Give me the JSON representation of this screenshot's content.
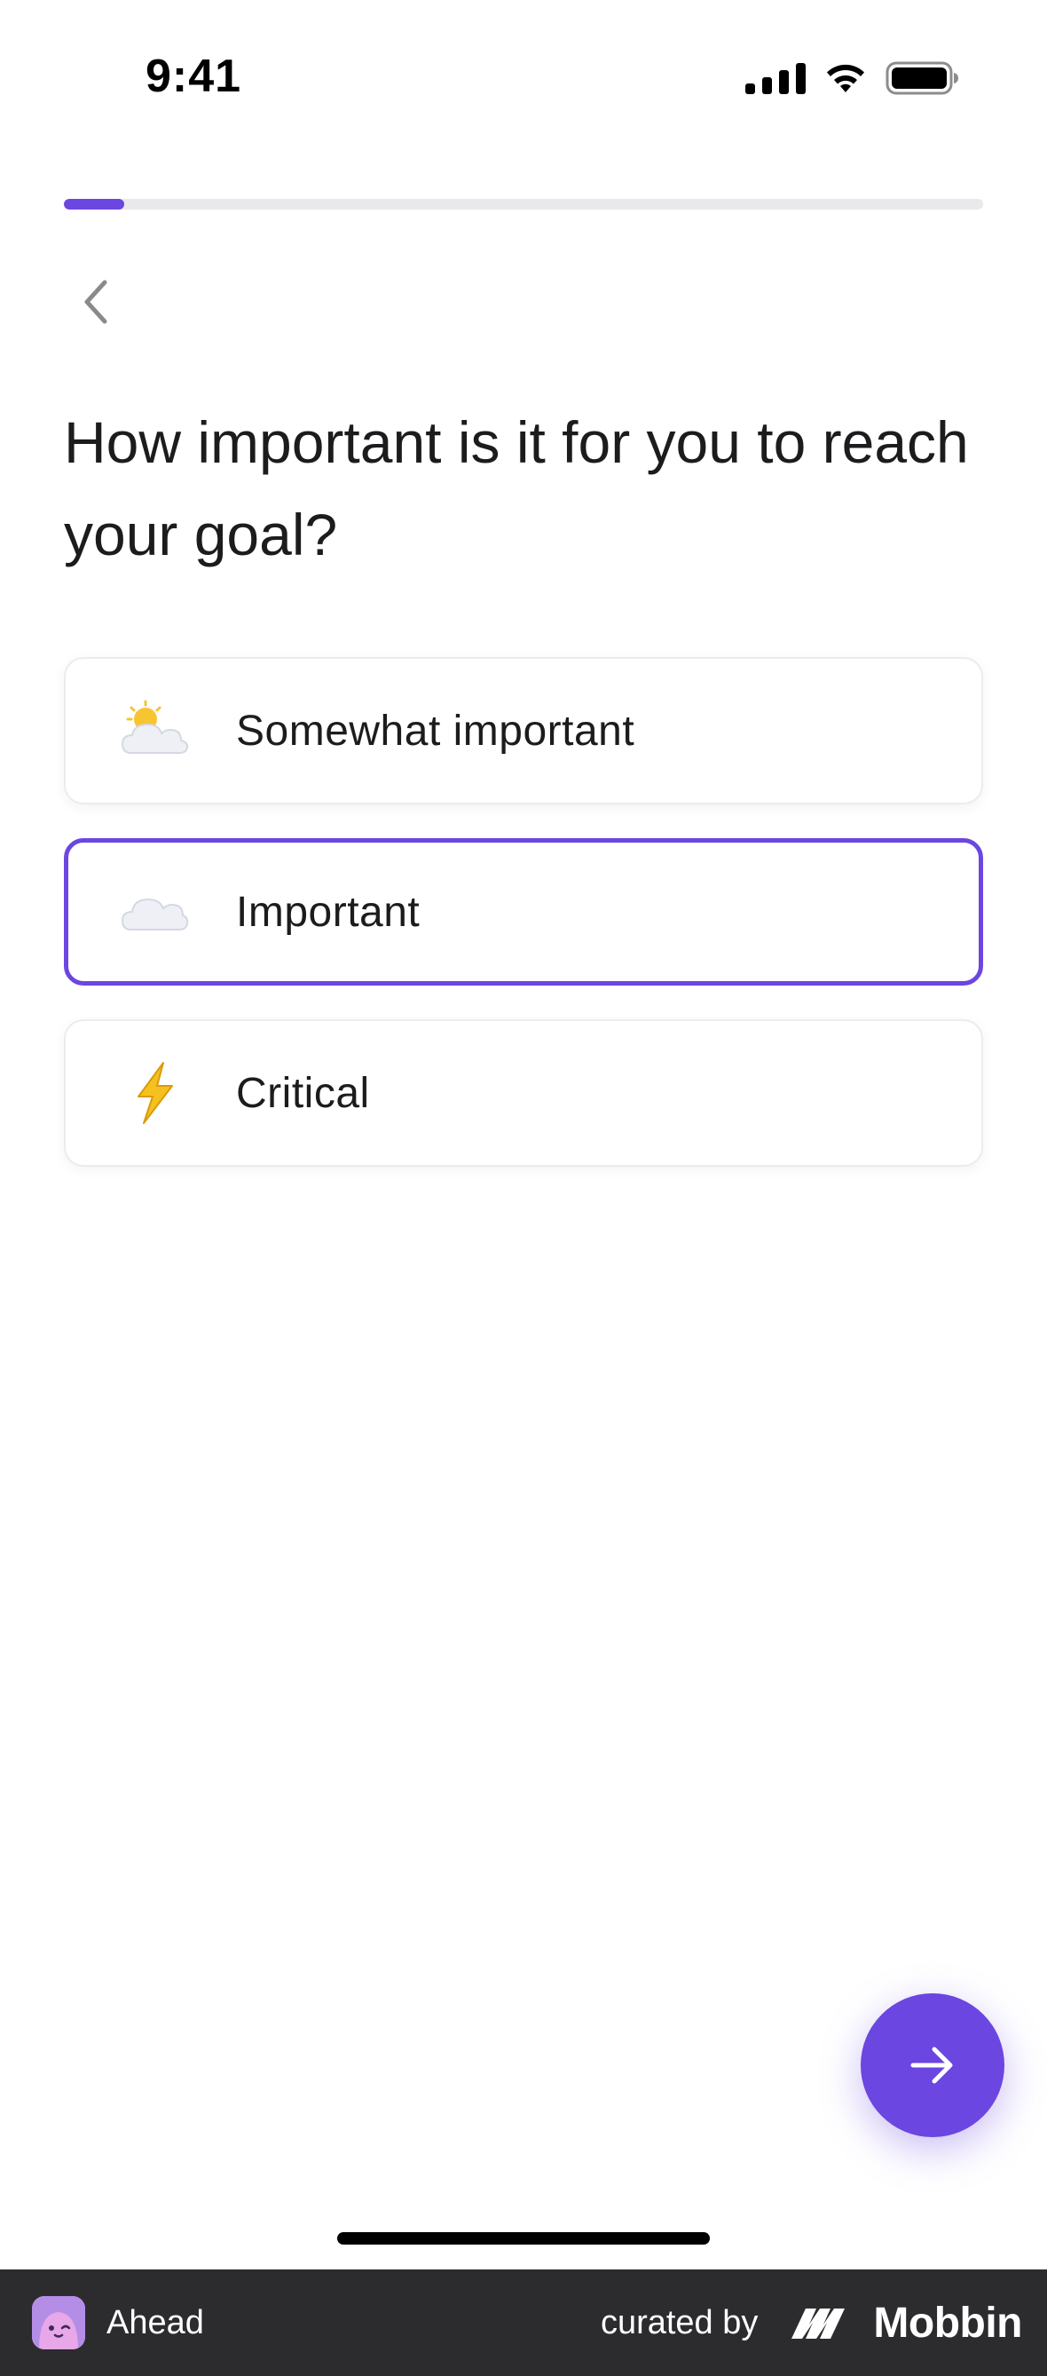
{
  "status_bar": {
    "time": "9:41"
  },
  "progress": {
    "fraction": 0.066
  },
  "question": {
    "text": "How important is it for you to reach your goal?"
  },
  "options": [
    {
      "label": "Somewhat important",
      "icon": "sun-behind-cloud-icon",
      "selected": false
    },
    {
      "label": "Important",
      "icon": "cloud-icon",
      "selected": true
    },
    {
      "label": "Critical",
      "icon": "lightning-icon",
      "selected": false
    }
  ],
  "footer": {
    "app_name": "Ahead",
    "curated_by": "curated by",
    "brand": "Mobbin"
  },
  "colors": {
    "accent": "#6b46e0",
    "footer_bg": "#2c2c2e"
  }
}
